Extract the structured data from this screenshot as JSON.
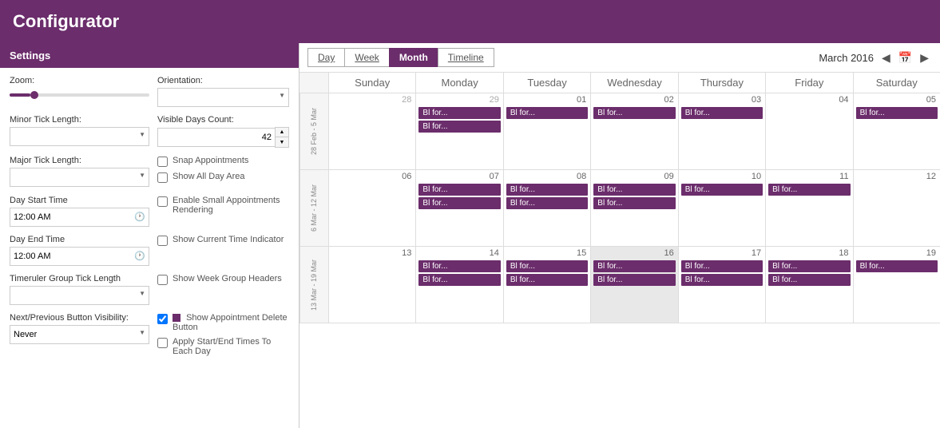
{
  "app": {
    "title": "Configurator"
  },
  "settings": {
    "header": "Settings",
    "zoom_label": "Zoom:",
    "orientation_label": "Orientation:",
    "minor_tick_label": "Minor Tick Length:",
    "visible_days_label": "Visible Days Count:",
    "visible_days_value": "42",
    "major_tick_label": "Major Tick Length:",
    "snap_appointments_label": "Snap Appointments",
    "show_all_day_label": "Show All Day Area",
    "day_start_label": "Day Start Time",
    "day_start_value": "12:00 AM",
    "enable_small_label": "Enable Small Appointments Rendering",
    "day_end_label": "Day End Time",
    "day_end_value": "12:00 AM",
    "show_current_time_label": "Show Current Time Indicator",
    "timeruler_label": "Timeruler Group Tick Length",
    "show_week_group_label": "Show Week Group Headers",
    "next_prev_label": "Next/Previous Button Visibility:",
    "next_prev_value": "Never",
    "show_delete_label": "Show Appointment Delete Button",
    "apply_start_end_label": "Apply Start/End Times To Each Day"
  },
  "calendar": {
    "views": [
      "Day",
      "Week",
      "Month",
      "Timeline"
    ],
    "active_view": "Month",
    "nav_label": "March 2016",
    "day_headers": [
      "Sunday",
      "Monday",
      "Tuesday",
      "Wednesday",
      "Thursday",
      "Friday",
      "Saturday"
    ],
    "weeks": [
      {
        "label": "28 Feb - 5 Mar",
        "days": [
          {
            "num": "28",
            "other": true,
            "events": []
          },
          {
            "num": "29",
            "other": true,
            "events": [
              "Bl for...",
              "Bl for..."
            ]
          },
          {
            "num": "01",
            "events": [
              "Bl for..."
            ]
          },
          {
            "num": "02",
            "events": [
              "Bl for..."
            ]
          },
          {
            "num": "03",
            "events": [
              "Bl for..."
            ]
          },
          {
            "num": "04",
            "events": []
          },
          {
            "num": "05",
            "events": [
              "Bl for..."
            ]
          }
        ]
      },
      {
        "label": "6 Mar - 12 Mar",
        "days": [
          {
            "num": "06",
            "events": []
          },
          {
            "num": "07",
            "events": [
              "Bl for...",
              "Bl for..."
            ]
          },
          {
            "num": "08",
            "events": [
              "Bl for...",
              "Bl for..."
            ]
          },
          {
            "num": "09",
            "events": [
              "Bl for...",
              "Bl for..."
            ]
          },
          {
            "num": "10",
            "events": [
              "Bl for..."
            ]
          },
          {
            "num": "11",
            "events": [
              "Bl for..."
            ]
          },
          {
            "num": "12",
            "events": []
          }
        ]
      },
      {
        "label": "13 Mar - 19 Mar",
        "days": [
          {
            "num": "13",
            "events": []
          },
          {
            "num": "14",
            "events": [
              "Bl for...",
              "Bl for..."
            ]
          },
          {
            "num": "15",
            "events": [
              "Bl for...",
              "Bl for..."
            ]
          },
          {
            "num": "16",
            "shaded": true,
            "events": [
              "Bl for...",
              "Bl for..."
            ]
          },
          {
            "num": "17",
            "events": [
              "Bl for...",
              "Bl for..."
            ]
          },
          {
            "num": "18",
            "events": [
              "Bl for...",
              "Bl for..."
            ]
          },
          {
            "num": "19",
            "events": [
              "Bl for..."
            ]
          }
        ]
      }
    ]
  }
}
